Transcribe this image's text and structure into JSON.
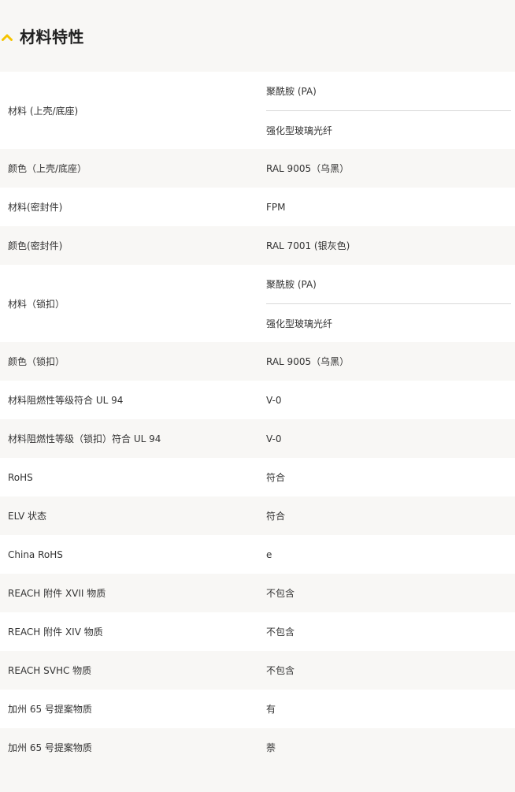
{
  "section": {
    "title": "材料特性",
    "accent_color": "#f5c400",
    "icon": "chevron-up-icon"
  },
  "rows": [
    {
      "label": "材料 (上壳/底座)",
      "values": [
        "聚酰胺 (PA)",
        "强化型玻璃光纤"
      ]
    },
    {
      "label": "颜色（上壳/底座）",
      "values": [
        "RAL 9005（乌黑）"
      ]
    },
    {
      "label": "材料(密封件)",
      "values": [
        "FPM"
      ]
    },
    {
      "label": "颜色(密封件)",
      "values": [
        "RAL 7001 (银灰色)"
      ]
    },
    {
      "label": "材料（锁扣）",
      "values": [
        "聚酰胺 (PA)",
        "强化型玻璃光纤"
      ]
    },
    {
      "label": "颜色（锁扣）",
      "values": [
        "RAL 9005（乌黑）"
      ]
    },
    {
      "label": "材料阻燃性等级符合 UL 94",
      "values": [
        "V-0"
      ]
    },
    {
      "label": "材料阻燃性等级（锁扣）符合 UL 94",
      "values": [
        "V-0"
      ]
    },
    {
      "label": "RoHS",
      "values": [
        "符合"
      ]
    },
    {
      "label": "ELV 状态",
      "values": [
        "符合"
      ]
    },
    {
      "label": "China RoHS",
      "values": [
        "e"
      ]
    },
    {
      "label": "REACH 附件 XVII 物质",
      "values": [
        "不包含"
      ]
    },
    {
      "label": "REACH 附件 XIV 物质",
      "values": [
        "不包含"
      ]
    },
    {
      "label": "REACH SVHC 物质",
      "values": [
        "不包含"
      ]
    },
    {
      "label": "加州 65 号提案物质",
      "values": [
        "有"
      ]
    },
    {
      "label": "加州 65 号提案物质",
      "values": [
        "萘"
      ]
    }
  ]
}
